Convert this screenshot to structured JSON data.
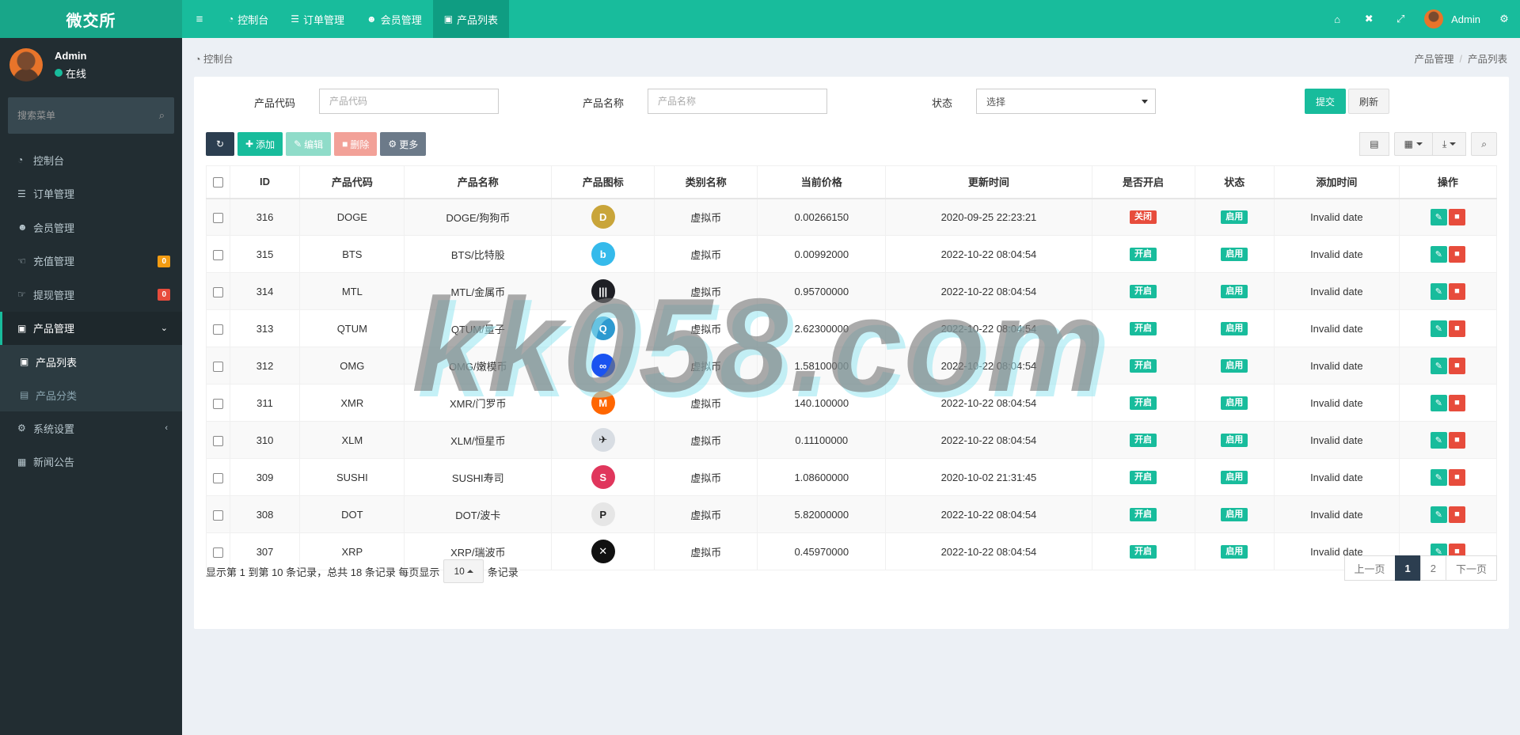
{
  "app": {
    "title": "微交所"
  },
  "user": {
    "name": "Admin",
    "status": "在线"
  },
  "sidebar": {
    "search_placeholder": "搜索菜单",
    "items": [
      {
        "label": "控制台",
        "icon": "dashboard-icon"
      },
      {
        "label": "订单管理",
        "icon": "list-icon"
      },
      {
        "label": "会员管理",
        "icon": "users-icon"
      },
      {
        "label": "充值管理",
        "icon": "hand-icon",
        "badge": "0",
        "badge_color": "#f39c12"
      },
      {
        "label": "提现管理",
        "icon": "hand-icon",
        "badge": "0",
        "badge_color": "#e74c3c"
      },
      {
        "label": "产品管理",
        "icon": "shopping-bag-icon"
      },
      {
        "label": "产品列表",
        "icon": "shopping-bag-icon"
      },
      {
        "label": "产品分类",
        "icon": "list-alt-icon"
      },
      {
        "label": "系统设置",
        "icon": "cogs-icon"
      },
      {
        "label": "新闻公告",
        "icon": "newspaper-icon"
      }
    ]
  },
  "topbar": {
    "tabs": [
      {
        "label": "控制台"
      },
      {
        "label": "订单管理"
      },
      {
        "label": "会员管理"
      },
      {
        "label": "产品列表"
      }
    ],
    "user_name": "Admin"
  },
  "breadcrumb": {
    "current": "控制台",
    "trail": [
      "产品管理",
      "产品列表"
    ]
  },
  "filters": {
    "code_label": "产品代码",
    "code_placeholder": "产品代码",
    "name_label": "产品名称",
    "name_placeholder": "产品名称",
    "status_label": "状态",
    "status_value": "选择",
    "submit": "提交",
    "reset": "刷新"
  },
  "toolbar": {
    "add": "添加",
    "edit": "编辑",
    "delete": "删除",
    "more": "更多"
  },
  "table": {
    "headers": [
      "ID",
      "产品代码",
      "产品名称",
      "产品图标",
      "类别名称",
      "当前价格",
      "更新时间",
      "是否开启",
      "状态",
      "添加时间",
      "操作"
    ],
    "rows": [
      {
        "id": "316",
        "code": "DOGE",
        "name": "DOGE/狗狗币",
        "icon": "doge-coin-icon",
        "icon_color": "#c9a53a",
        "category": "虚拟币",
        "price": "0.00266150",
        "updated": "2020-09-25 22:23:21",
        "enabled": "关闭",
        "enabled_color": "#e74c3c",
        "status": "启用",
        "added": "Invalid date"
      },
      {
        "id": "315",
        "code": "BTS",
        "name": "BTS/比特股",
        "icon": "bts-coin-icon",
        "icon_color": "#35baeb",
        "category": "虚拟币",
        "price": "0.00992000",
        "updated": "2022-10-22 08:04:54",
        "enabled": "开启",
        "enabled_color": "#18bc9c",
        "status": "启用",
        "added": "Invalid date"
      },
      {
        "id": "314",
        "code": "MTL",
        "name": "MTL/金属币",
        "icon": "mtl-coin-icon",
        "icon_color": "#1e1f25",
        "category": "虚拟币",
        "price": "0.95700000",
        "updated": "2022-10-22 08:04:54",
        "enabled": "开启",
        "enabled_color": "#18bc9c",
        "status": "启用",
        "added": "Invalid date"
      },
      {
        "id": "313",
        "code": "QTUM",
        "name": "QTUM/量子",
        "icon": "qtum-coin-icon",
        "icon_color": "#2e9ad0",
        "category": "虚拟币",
        "price": "2.62300000",
        "updated": "2022-10-22 08:04:54",
        "enabled": "开启",
        "enabled_color": "#18bc9c",
        "status": "启用",
        "added": "Invalid date"
      },
      {
        "id": "312",
        "code": "OMG",
        "name": "OMG/嫩模币",
        "icon": "omg-coin-icon",
        "icon_color": "#1a53f0",
        "category": "虚拟币",
        "price": "1.58100000",
        "updated": "2022-10-22 08:04:54",
        "enabled": "开启",
        "enabled_color": "#18bc9c",
        "status": "启用",
        "added": "Invalid date"
      },
      {
        "id": "311",
        "code": "XMR",
        "name": "XMR/门罗币",
        "icon": "xmr-coin-icon",
        "icon_color": "#ff6600",
        "category": "虚拟币",
        "price": "140.100000",
        "updated": "2022-10-22 08:04:54",
        "enabled": "开启",
        "enabled_color": "#18bc9c",
        "status": "启用",
        "added": "Invalid date"
      },
      {
        "id": "310",
        "code": "XLM",
        "name": "XLM/恒星币",
        "icon": "xlm-coin-icon",
        "icon_color": "#d8dde3",
        "category": "虚拟币",
        "price": "0.11100000",
        "updated": "2022-10-22 08:04:54",
        "enabled": "开启",
        "enabled_color": "#18bc9c",
        "status": "启用",
        "added": "Invalid date"
      },
      {
        "id": "309",
        "code": "SUSHI",
        "name": "SUSHI寿司",
        "icon": "sushi-coin-icon",
        "icon_color": "#e0365c",
        "category": "虚拟币",
        "price": "1.08600000",
        "updated": "2020-10-02 21:31:45",
        "enabled": "开启",
        "enabled_color": "#18bc9c",
        "status": "启用",
        "added": "Invalid date"
      },
      {
        "id": "308",
        "code": "DOT",
        "name": "DOT/波卡",
        "icon": "dot-coin-icon",
        "icon_color": "#e6e6e6",
        "category": "虚拟币",
        "price": "5.82000000",
        "updated": "2022-10-22 08:04:54",
        "enabled": "开启",
        "enabled_color": "#18bc9c",
        "status": "启用",
        "added": "Invalid date"
      },
      {
        "id": "307",
        "code": "XRP",
        "name": "XRP/瑞波币",
        "icon": "xrp-coin-icon",
        "icon_color": "#111111",
        "category": "虚拟币",
        "price": "0.45970000",
        "updated": "2022-10-22 08:04:54",
        "enabled": "开启",
        "enabled_color": "#18bc9c",
        "status": "启用",
        "added": "Invalid date"
      }
    ]
  },
  "pager": {
    "info_prefix": "显示第 1 到第 10 条记录，总共 18 条记录 每页显示",
    "page_size": "10",
    "info_suffix": "条记录",
    "prev": "上一页",
    "pages": [
      "1",
      "2"
    ],
    "next": "下一页"
  },
  "watermark": "kk058.com",
  "colors": {
    "accent": "#18bc9c",
    "sidebar": "#222d32",
    "danger": "#e74c3c",
    "dark": "#2c3e50"
  }
}
